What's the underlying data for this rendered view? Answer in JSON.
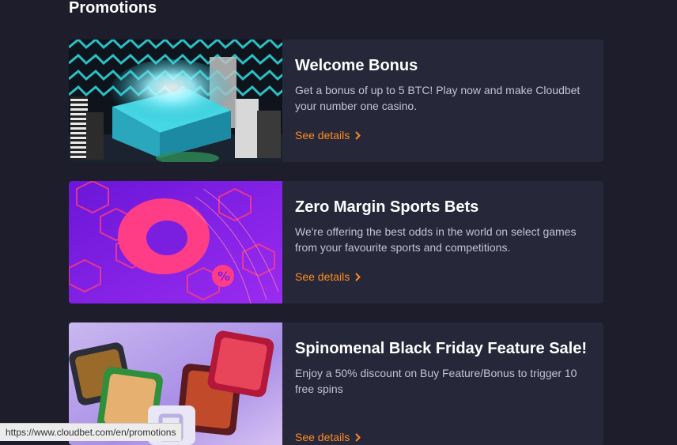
{
  "page": {
    "section_title": "Promotions"
  },
  "promotions": [
    {
      "title": "Welcome Bonus",
      "description": "Get a bonus of up to 5 BTC! Play now and make Cloudbet your number one casino.",
      "link_label": "See details"
    },
    {
      "title": "Zero Margin Sports Bets",
      "description": "We're offering the best odds in the world on select games from your favourite sports and competitions.",
      "link_label": "See details"
    },
    {
      "title": "Spinomenal Black Friday Feature Sale!",
      "description": "Enjoy a 50% discount on Buy Feature/Bonus to trigger 10 free spins",
      "link_label": "See details"
    }
  ],
  "status_bar": {
    "url": "https://www.cloudbet.com/en/promotions"
  },
  "colors": {
    "background": "#1d1d2b",
    "card": "#262839",
    "accent": "#ff8a22"
  },
  "icons": {
    "link_arrow": "chevron-right-icon"
  }
}
